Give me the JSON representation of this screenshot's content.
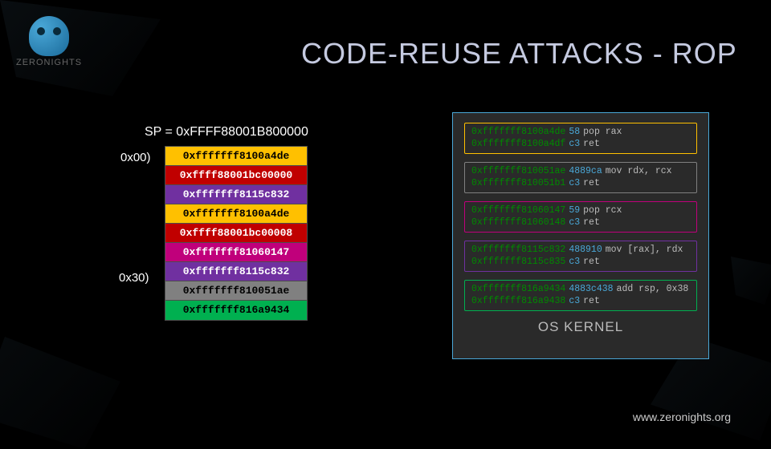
{
  "brand": {
    "name": "ZERONIGHTS",
    "url": "www.zeronights.org"
  },
  "title": "CODE-REUSE ATTACKS - ROP",
  "sp": {
    "label": "SP = 0xFFFF88001B800000"
  },
  "offsets": {
    "start": "0x00)",
    "after": "0x30)"
  },
  "stack": [
    {
      "text": "0xfffffff8100a4de",
      "cls": "c-yellow"
    },
    {
      "text": "0xffff88001bc00000",
      "cls": "c-red"
    },
    {
      "text": "0xfffffff8115c832",
      "cls": "c-purple"
    },
    {
      "text": "0xfffffff8100a4de",
      "cls": "c-yellow"
    },
    {
      "text": "0xffff88001bc00008",
      "cls": "c-red"
    },
    {
      "text": "0xfffffff81060147",
      "cls": "c-mag"
    },
    {
      "text": "0xfffffff8115c832",
      "cls": "c-purple"
    },
    {
      "text": "0xfffffff810051ae",
      "cls": "c-gray"
    },
    {
      "text": "0xfffffff816a9434",
      "cls": "c-green"
    }
  ],
  "kernel": {
    "label": "OS KERNEL",
    "gadgets": [
      {
        "cls": "g-yellow",
        "lines": [
          {
            "addr": "0xfffffff8100a4de",
            "hex": "58",
            "mnem": "pop rax"
          },
          {
            "addr": "0xfffffff8100a4df",
            "hex": "c3",
            "mnem": "ret"
          }
        ]
      },
      {
        "cls": "g-gray",
        "lines": [
          {
            "addr": "0xfffffff810051ae",
            "hex": "4889ca",
            "mnem": "mov rdx, rcx"
          },
          {
            "addr": "0xfffffff810051b1",
            "hex": "c3",
            "mnem": "ret"
          }
        ]
      },
      {
        "cls": "g-mag",
        "lines": [
          {
            "addr": "0xfffffff81060147",
            "hex": "59",
            "mnem": "pop rcx"
          },
          {
            "addr": "0xfffffff81060148",
            "hex": "c3",
            "mnem": "ret"
          }
        ]
      },
      {
        "cls": "g-purple",
        "lines": [
          {
            "addr": "0xfffffff8115c832",
            "hex": "488910",
            "mnem": "mov [rax], rdx"
          },
          {
            "addr": "0xfffffff8115c835",
            "hex": "c3",
            "mnem": "ret"
          }
        ]
      },
      {
        "cls": "g-green",
        "lines": [
          {
            "addr": "0xfffffff816a9434",
            "hex": "4883c438",
            "mnem": "add rsp, 0x38"
          },
          {
            "addr": "0xfffffff816a9438",
            "hex": "c3",
            "mnem": "ret"
          }
        ]
      }
    ]
  }
}
